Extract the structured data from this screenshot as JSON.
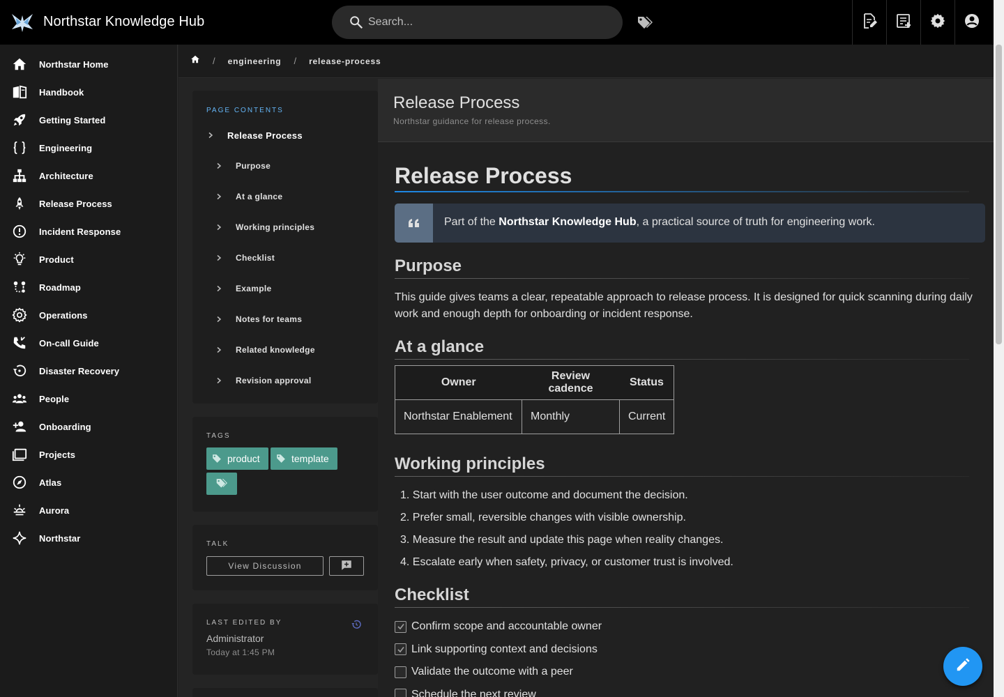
{
  "app": {
    "title": "Northstar Knowledge Hub"
  },
  "search": {
    "placeholder": "Search..."
  },
  "sidebar": {
    "items": [
      {
        "label": "Northstar Home",
        "icon": "home-icon"
      },
      {
        "label": "Handbook",
        "icon": "book-icon"
      },
      {
        "label": "Getting Started",
        "icon": "rocket-icon"
      },
      {
        "label": "Engineering",
        "icon": "code-braces-icon"
      },
      {
        "label": "Architecture",
        "icon": "sitemap-icon"
      },
      {
        "label": "Release Process",
        "icon": "rocket-launch-icon"
      },
      {
        "label": "Incident Response",
        "icon": "alert-circle-icon"
      },
      {
        "label": "Product",
        "icon": "lightbulb-icon"
      },
      {
        "label": "Roadmap",
        "icon": "map-marker-path-icon"
      },
      {
        "label": "Operations",
        "icon": "cog-icon"
      },
      {
        "label": "On-call Guide",
        "icon": "phone-icon"
      },
      {
        "label": "Disaster Recovery",
        "icon": "restore-icon"
      },
      {
        "label": "People",
        "icon": "account-group-icon"
      },
      {
        "label": "Onboarding",
        "icon": "account-plus-icon"
      },
      {
        "label": "Projects",
        "icon": "folder-multiple-icon"
      },
      {
        "label": "Atlas",
        "icon": "compass-icon"
      },
      {
        "label": "Aurora",
        "icon": "weather-sunset-icon"
      },
      {
        "label": "Northstar",
        "icon": "star-four-points-icon"
      }
    ]
  },
  "breadcrumb": {
    "items": [
      "engineering",
      "release-process"
    ]
  },
  "toc": {
    "title": "PAGE CONTENTS",
    "top": "Release Process",
    "items": [
      "Purpose",
      "At a glance",
      "Working principles",
      "Checklist",
      "Example",
      "Notes for teams",
      "Related knowledge",
      "Revision approval"
    ]
  },
  "tags": {
    "title": "TAGS",
    "items": [
      "product",
      "template"
    ]
  },
  "talk": {
    "title": "TALK",
    "button": "View Discussion"
  },
  "last_edited": {
    "title": "LAST EDITED BY",
    "name": "Administrator",
    "time": "Today at 1:45 PM"
  },
  "header": {
    "title": "Release Process",
    "subtitle": "Northstar guidance for release process."
  },
  "article": {
    "h1": "Release Process",
    "quote": {
      "before": "Part of the ",
      "bold": "Northstar Knowledge Hub",
      "after": ", a practical source of truth for engineering work."
    },
    "purpose": {
      "heading": "Purpose",
      "text": "This guide gives teams a clear, repeatable approach to release process. It is designed for quick scanning during daily work and enough depth for onboarding or incident response."
    },
    "glance": {
      "heading": "At a glance",
      "headers": [
        "Owner",
        "Review cadence",
        "Status"
      ],
      "row": [
        "Northstar Enablement",
        "Monthly",
        "Current"
      ]
    },
    "principles": {
      "heading": "Working principles",
      "items": [
        "1. Start with the user outcome and document the decision.",
        "2. Prefer small, reversible changes with visible ownership.",
        "3. Measure the result and update this page when reality changes.",
        "4. Escalate early when safety, privacy, or customer trust is involved."
      ]
    },
    "checklist": {
      "heading": "Checklist",
      "items": [
        {
          "label": "Confirm scope and accountable owner",
          "checked": true
        },
        {
          "label": "Link supporting context and decisions",
          "checked": true
        },
        {
          "label": "Validate the outcome with a peer",
          "checked": false
        },
        {
          "label": "Schedule the next review",
          "checked": false
        }
      ]
    }
  },
  "colors": {
    "accent": "#2196f3",
    "tag": "#4c9a8c",
    "toc_title": "#64b5f6"
  }
}
